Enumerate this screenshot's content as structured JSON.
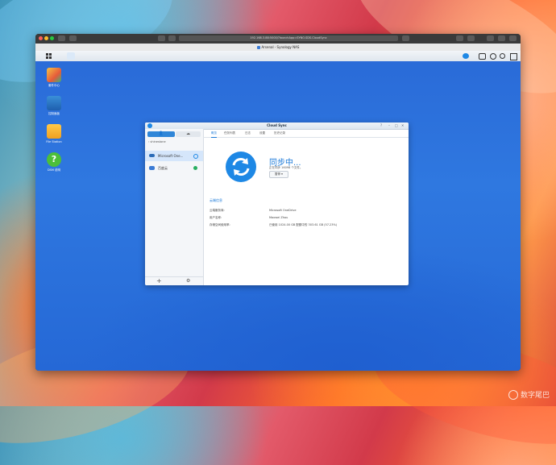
{
  "browser": {
    "address": "192.168.3.88:5000/?launchApp=SYNO.SDS.CloudSync",
    "tab_title": "Arsenal - Synology NAS"
  },
  "desktop": {
    "icons": [
      {
        "label": "套件中心",
        "icon": "package-center-icon"
      },
      {
        "label": "控制面板",
        "icon": "control-panel-icon"
      },
      {
        "label": "File Station",
        "icon": "folder-icon"
      },
      {
        "label": "DSM 说明",
        "icon": "help-icon"
      }
    ]
  },
  "cloudsync": {
    "title": "Cloud Sync",
    "user": "shinestone",
    "connections": [
      {
        "name": "Microsoft One...",
        "status": "syncing",
        "selected": true
      },
      {
        "name": "百度云",
        "status": "ok",
        "selected": false
      }
    ],
    "tabs": [
      "概览",
      "任务列表",
      "日志",
      "设置",
      "历史记录"
    ],
    "active_tab": "概览",
    "status_title": "同步中...",
    "status_sub": "正在同步 16098 个文件。",
    "pause_label": "暂停",
    "section_title": "云端信息",
    "info": [
      {
        "key": "云端服务商:",
        "value": "Microsoft OneDrive"
      },
      {
        "key": "用户名称:",
        "value": "Maxwei Zhou"
      },
      {
        "key": "存储空间使用率:",
        "value": "已使用 1024.00 GB 配额中的 303.61 GB (57.23%)"
      }
    ]
  },
  "watermark": "数字尾巴",
  "colors": {
    "accent": "#1c7ad8",
    "sync_icon": "#1e88e5",
    "ok_green": "#27ae60"
  }
}
